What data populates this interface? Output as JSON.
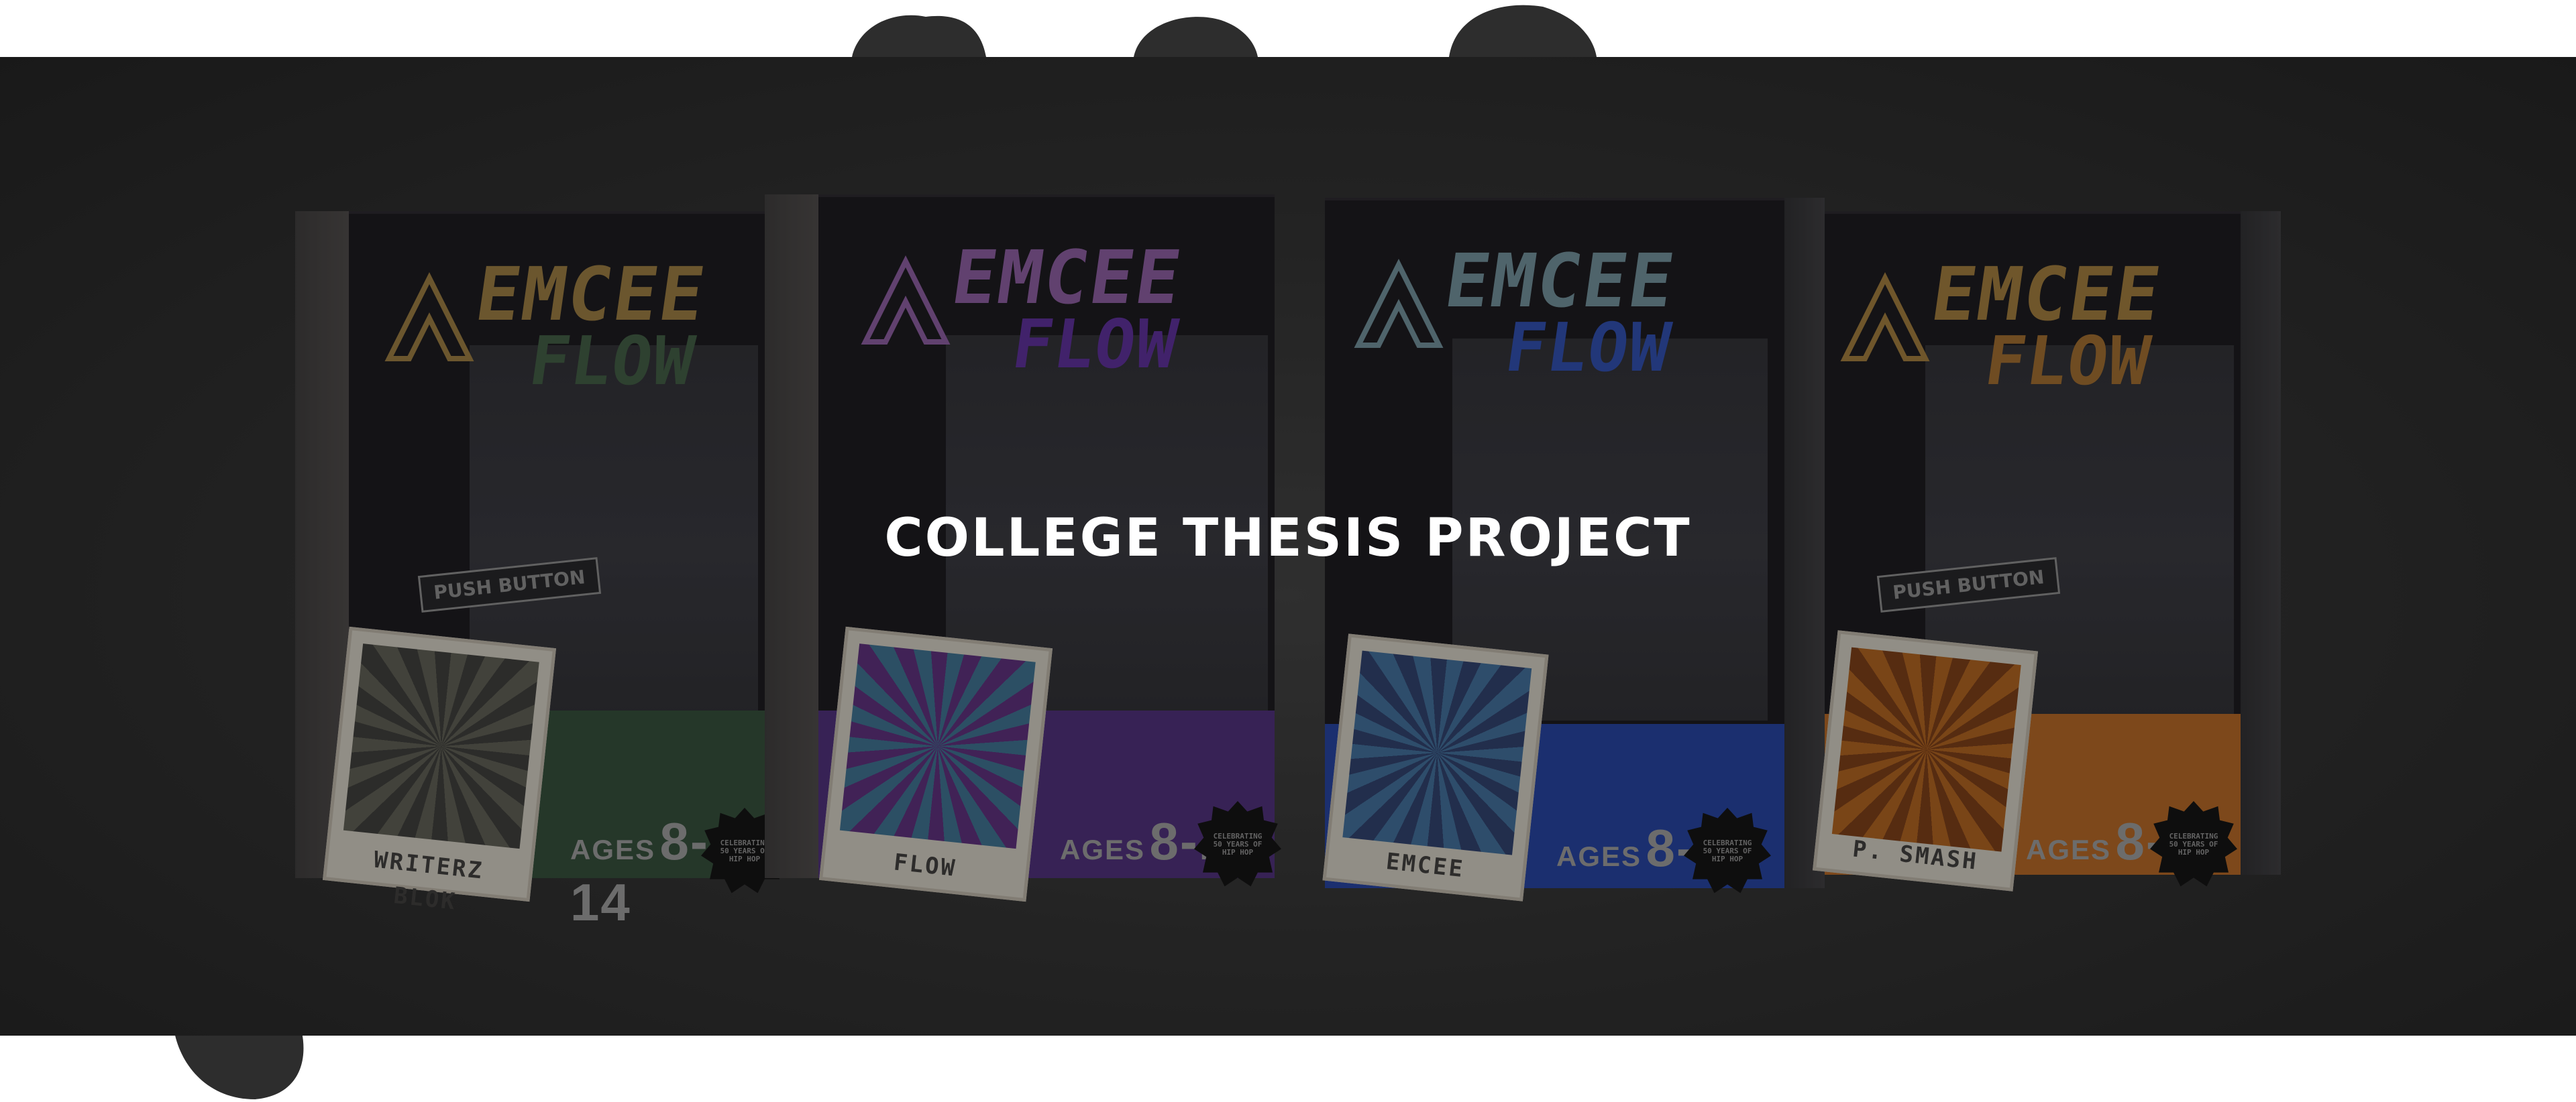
{
  "hero": {
    "title": "COLLEGE THESIS PROJECT",
    "colors": {
      "band": "#2c2c2c",
      "title": "#ffffff",
      "page": "#ffffff"
    }
  },
  "product": {
    "logo_top": "EMCEE",
    "logo_plus": "+",
    "logo_bottom": "FLOW",
    "push_button": "PUSH BUTTON",
    "ages_prefix": "AGES",
    "ages_range": "8-14",
    "burst_text": "CELEBRATING 50 YEARS OF HIP HOP"
  },
  "boxes": [
    {
      "card_name": "WRITERZ BLOK",
      "accent": "#2e4a35",
      "logo_color": "#9a7a3c",
      "flow_color": "#3c5a3f",
      "art_bg": "#5b5b50",
      "icon": "graffiti-artist"
    },
    {
      "card_name": "FLOW",
      "accent": "#4a2a78",
      "logo_color": "#8a5aa0",
      "flow_color": "#5a2a9a",
      "art_bg": "#3a6f8f",
      "icon": "rapper-woman"
    },
    {
      "card_name": "EMCEE",
      "accent": "#1f3ea0",
      "logo_color": "#6f8f9a",
      "flow_color": "#2a4ab0",
      "art_bg": "#3c6c9a",
      "icon": "emcee-mic"
    },
    {
      "card_name": "P. SMASH",
      "accent": "#b5651f",
      "logo_color": "#a07a38",
      "flow_color": "#a06a2a",
      "art_bg": "#b0601a",
      "icon": "dj-producer"
    }
  ]
}
